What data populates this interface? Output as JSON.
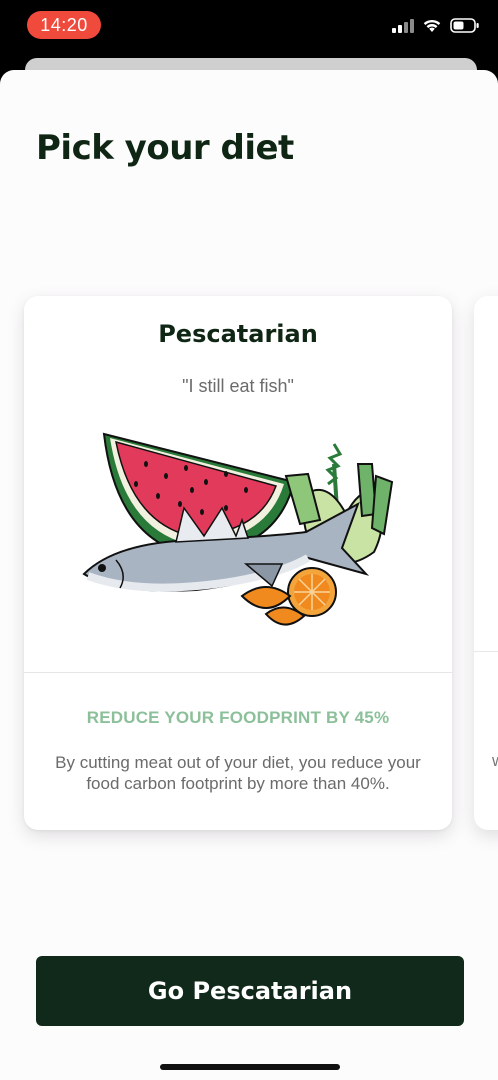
{
  "status_bar": {
    "time": "14:20",
    "icons": [
      "cellular-signal-icon",
      "wifi-icon",
      "battery-icon"
    ],
    "time_pill_color": "#f04a3c"
  },
  "page": {
    "title": "Pick your diet"
  },
  "card": {
    "title": "Pescatarian",
    "subtitle": "\"I still eat fish\"",
    "illustration": "fish-watermelon-fennel-orange-illustration",
    "reduce_label": "REDUCE YOUR FOODPRINT BY 45%",
    "description": "By cutting meat out of your diet, you reduce your food carbon footprint by more than 40%."
  },
  "next_card": {
    "fragment": "w"
  },
  "cta": {
    "label": "Go Pescatarian",
    "color": "#10291a"
  },
  "colors": {
    "accent_green": "#8cc09a",
    "title_dark_green": "#0f2614",
    "background": "#fdfcfd"
  }
}
